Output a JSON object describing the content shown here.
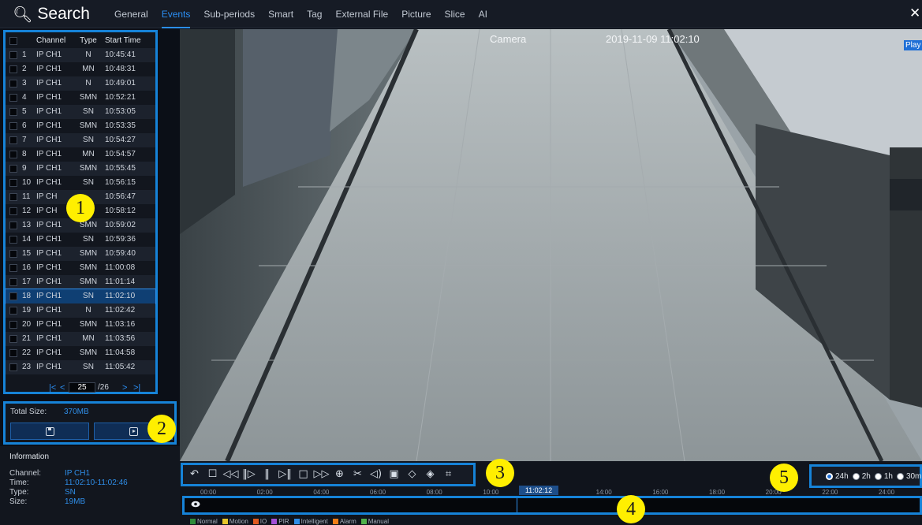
{
  "header": {
    "title": "Search",
    "tabs": [
      "General",
      "Events",
      "Sub-periods",
      "Smart",
      "Tag",
      "External File",
      "Picture",
      "Slice",
      "AI"
    ],
    "active_tab": "Events",
    "close_label": "✕"
  },
  "event_list": {
    "columns": [
      "Channel",
      "Type",
      "Start Time"
    ],
    "rows": [
      {
        "num": "1",
        "channel": "IP CH1",
        "type": "N",
        "time": "10:45:41"
      },
      {
        "num": "2",
        "channel": "IP CH1",
        "type": "MN",
        "time": "10:48:31"
      },
      {
        "num": "3",
        "channel": "IP CH1",
        "type": "N",
        "time": "10:49:01"
      },
      {
        "num": "4",
        "channel": "IP CH1",
        "type": "SMN",
        "time": "10:52:21"
      },
      {
        "num": "5",
        "channel": "IP CH1",
        "type": "SN",
        "time": "10:53:05"
      },
      {
        "num": "6",
        "channel": "IP CH1",
        "type": "SMN",
        "time": "10:53:35"
      },
      {
        "num": "7",
        "channel": "IP CH1",
        "type": "SN",
        "time": "10:54:27"
      },
      {
        "num": "8",
        "channel": "IP CH1",
        "type": "MN",
        "time": "10:54:57"
      },
      {
        "num": "9",
        "channel": "IP CH1",
        "type": "SMN",
        "time": "10:55:45"
      },
      {
        "num": "10",
        "channel": "IP CH1",
        "type": "SN",
        "time": "10:56:15"
      },
      {
        "num": "11",
        "channel": "IP CH",
        "type": "",
        "time": "10:56:47"
      },
      {
        "num": "12",
        "channel": "IP CH",
        "type": "",
        "time": "10:58:12"
      },
      {
        "num": "13",
        "channel": "IP CH1",
        "type": "SMN",
        "time": "10:59:02"
      },
      {
        "num": "14",
        "channel": "IP CH1",
        "type": "SN",
        "time": "10:59:36"
      },
      {
        "num": "15",
        "channel": "IP CH1",
        "type": "SMN",
        "time": "10:59:40"
      },
      {
        "num": "16",
        "channel": "IP CH1",
        "type": "SMN",
        "time": "11:00:08"
      },
      {
        "num": "17",
        "channel": "IP CH1",
        "type": "SMN",
        "time": "11:01:14"
      },
      {
        "num": "18",
        "channel": "IP CH1",
        "type": "SN",
        "time": "11:02:10"
      },
      {
        "num": "19",
        "channel": "IP CH1",
        "type": "N",
        "time": "11:02:42"
      },
      {
        "num": "20",
        "channel": "IP CH1",
        "type": "SMN",
        "time": "11:03:16"
      },
      {
        "num": "21",
        "channel": "IP CH1",
        "type": "MN",
        "time": "11:03:56"
      },
      {
        "num": "22",
        "channel": "IP CH1",
        "type": "SMN",
        "time": "11:04:58"
      },
      {
        "num": "23",
        "channel": "IP CH1",
        "type": "SN",
        "time": "11:05:42"
      }
    ],
    "selected_row": 18,
    "pager": {
      "first": "|<",
      "prev": "<",
      "current_page": "25",
      "total": "/26",
      "next": ">",
      "last": ">|"
    }
  },
  "size_panel": {
    "total_size_label": "Total Size:",
    "total_size_value": "370MB"
  },
  "info": {
    "heading": "Information",
    "channel_label": "Channel:",
    "channel_value": "IP CH1",
    "time_label": "Time:",
    "time_value": "11:02:10-11:02:46",
    "type_label": "Type:",
    "type_value": "SN",
    "size_label": "Size:",
    "size_value": "19MB"
  },
  "video": {
    "camera_label": "Camera",
    "timestamp": "2019-11-09 11:02:10",
    "play_tag": "Play"
  },
  "toolbar": {
    "icons": [
      "back-icon",
      "fullscreen-icon",
      "rewind-icon",
      "step-play-icon",
      "pause-icon",
      "step-forward-icon",
      "stop-icon",
      "fast-forward-icon",
      "zoom-icon",
      "cut-icon",
      "volume-icon",
      "snapshot-icon",
      "tag-icon",
      "custom-tag-icon",
      "crop-icon"
    ]
  },
  "timescale": {
    "options": [
      "24h",
      "2h",
      "1h",
      "30m"
    ],
    "selected": "24h"
  },
  "timeline": {
    "ticks": [
      "00:00",
      "02:00",
      "04:00",
      "06:00",
      "08:00",
      "10:00",
      "12:00",
      "14:00",
      "16:00",
      "18:00",
      "20:00",
      "22:00",
      "24:00"
    ],
    "current_time": "11:02:12",
    "cursor_fraction": 0.4598
  },
  "legend": [
    {
      "label": "Normal",
      "color": "#2e8b3a"
    },
    {
      "label": "Motion",
      "color": "#e6c52a"
    },
    {
      "label": "IO",
      "color": "#e05a1f"
    },
    {
      "label": "PIR",
      "color": "#a24fd6"
    },
    {
      "label": "Intelligent",
      "color": "#2f8ee8"
    },
    {
      "label": "Alarm",
      "color": "#f07d16"
    },
    {
      "label": "Manual",
      "color": "#4fb14a"
    }
  ],
  "callouts": [
    "1",
    "2",
    "3",
    "4",
    "5"
  ],
  "colors": {
    "accent": "#1683d8",
    "marker": "#ffef00"
  }
}
